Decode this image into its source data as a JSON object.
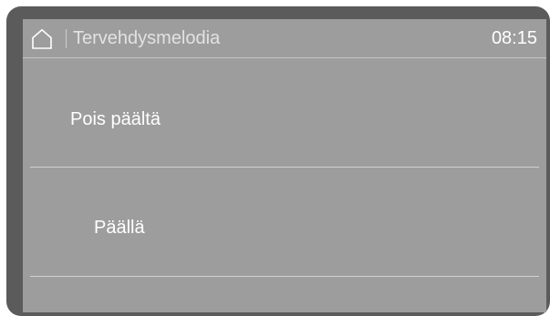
{
  "header": {
    "home_icon": "home-icon",
    "title": "Tervehdysmelodia",
    "clock": "08:15"
  },
  "options": [
    {
      "label": "Pois päältä"
    },
    {
      "label": "Päällä"
    }
  ],
  "colors": {
    "frame": "#5b5b5b",
    "screen_background": "#9d9d9d",
    "text": "#ffffff",
    "title_text": "#e2e2e2",
    "divider": "#d0d0d0"
  }
}
